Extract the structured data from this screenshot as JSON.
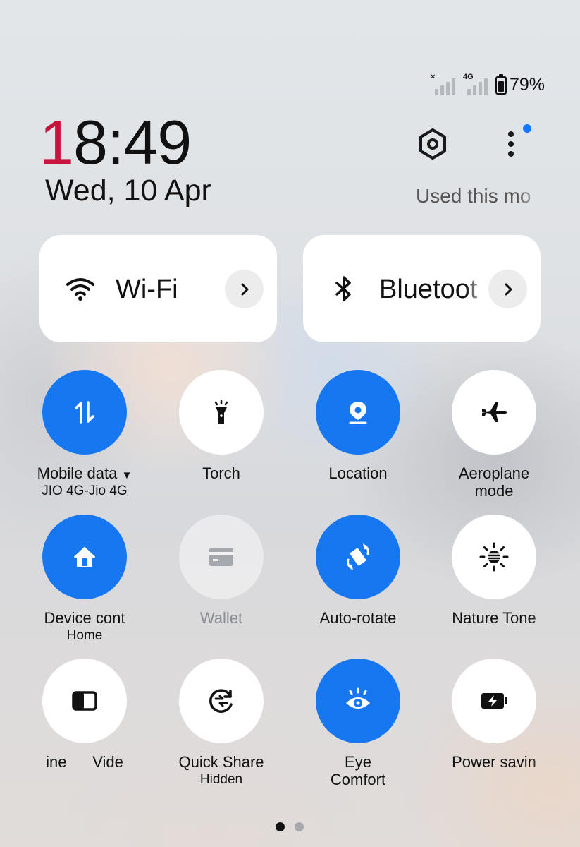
{
  "status_bar": {
    "sim1_tag": "×",
    "sim2_tag": "4G",
    "battery_percent_value": 79,
    "battery_text": "79%"
  },
  "clock": {
    "hour_first_digit": "1",
    "rest": "8:49",
    "date": "Wed, 10 Apr"
  },
  "header": {
    "settings_icon": "settings-hexagon-icon",
    "more_icon": "more-vertical-icon",
    "used_text": "Used this mo",
    "accent": "#1677f0",
    "clock_accent": "#c8143f"
  },
  "tiles": {
    "wifi": {
      "label": "Wi-Fi",
      "icon": "wifi-icon"
    },
    "bluetooth": {
      "label": "Bluetoot",
      "icon": "bluetooth-icon"
    }
  },
  "toggles": {
    "mobile_data": {
      "label": "Mobile data",
      "sub": "JIO 4G-Jio 4G",
      "on": true
    },
    "torch": {
      "label": "Torch",
      "on": false
    },
    "location": {
      "label": "Location",
      "on": true
    },
    "aeroplane": {
      "label": "Aeroplane",
      "sub": "mode",
      "on": false
    },
    "device_controls": {
      "label": "Device cont",
      "sub": "Home",
      "on": true
    },
    "wallet": {
      "label": "Wallet",
      "on": false,
      "disabled": true
    },
    "auto_rotate": {
      "label": "Auto-rotate",
      "on": true
    },
    "nature_tone": {
      "label": "Nature Tone",
      "on": false
    },
    "video": {
      "label": "ine      Vide",
      "on": false
    },
    "quick_share": {
      "label": "Quick Share",
      "sub": "Hidden",
      "on": false
    },
    "eye_comfort": {
      "label": "Eye",
      "sub": "Comfort",
      "on": true
    },
    "power_saving": {
      "label": "Power savin",
      "on": false
    }
  },
  "pager": {
    "pages": 2,
    "active": 1
  }
}
